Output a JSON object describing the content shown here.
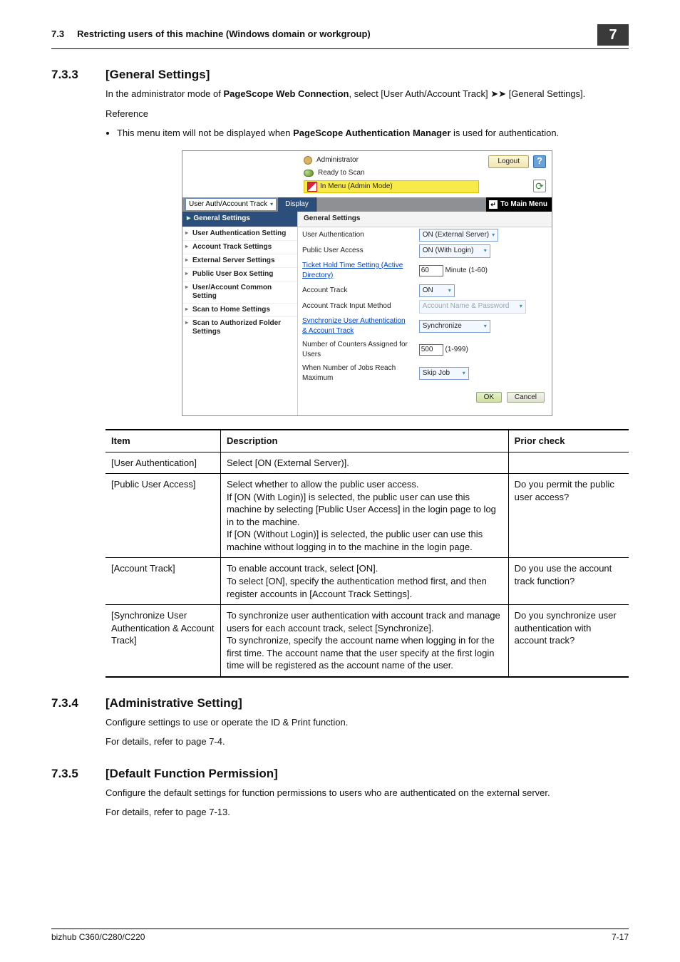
{
  "header": {
    "section_number": "7.3",
    "title": "Restricting users of this machine (Windows domain or workgroup)",
    "chapter": "7"
  },
  "sec_733": {
    "num": "7.3.3",
    "title": "[General Settings]",
    "intro_pre": "In the administrator mode of ",
    "intro_bold1": "PageScope Web Connection",
    "intro_mid": ", select [User Auth/Account Track] ",
    "intro_arrow": "➤➤",
    "intro_post": " [General Settings].",
    "reference_label": "Reference",
    "bullet_pre": "This menu item will not be displayed when ",
    "bullet_bold": "PageScope Authentication Manager",
    "bullet_post": " is used for authentication."
  },
  "panel": {
    "admin_label": "Administrator",
    "logout": "Logout",
    "help": "?",
    "ready": "Ready to Scan",
    "mode": "In Menu (Admin Mode)",
    "bar_select": "User Auth/Account Track",
    "display": "Display",
    "to_main": "To Main Menu",
    "nav_head": "General Settings",
    "nav_items": [
      "User Authentication Setting",
      "Account Track Settings",
      "External Server Settings",
      "Public User Box Setting",
      "User/Account Common Setting",
      "Scan to Home Settings",
      "Scan to Authorized Folder Settings"
    ],
    "title": "General Settings",
    "rows": {
      "ua_label": "User Authentication",
      "ua_value": "ON (External Server)",
      "pua_label": "Public User Access",
      "pua_value": "ON (With Login)",
      "ticket_label": "Ticket Hold Time Setting (Active Directory)",
      "ticket_value": "60",
      "ticket_suffix": "Minute (1-60)",
      "at_label": "Account Track",
      "at_value": "ON",
      "atim_label": "Account Track Input Method",
      "atim_value": "Account Name & Password",
      "sync_label": "Synchronize User Authentication & Account Track",
      "sync_value": "Synchronize",
      "num_label": "Number of Counters Assigned for Users",
      "num_value": "500",
      "num_suffix": "(1-999)",
      "max_label": "When Number of Jobs Reach Maximum",
      "max_value": "Skip Job"
    },
    "ok": "OK",
    "cancel": "Cancel"
  },
  "table": {
    "head_item": "Item",
    "head_desc": "Description",
    "head_prior": "Prior check",
    "rows": [
      {
        "item": "[User Authentication]",
        "desc": "Select [ON (External Server)].",
        "prior": ""
      },
      {
        "item": "[Public User Access]",
        "desc": "Select whether to allow the public user access.\nIf [ON (With Login)] is selected, the public user can use this machine by selecting [Public User Access] in the login page to log in to the machine.\nIf [ON (Without Login)] is selected, the public user can use this machine without logging in to the machine in the login page.",
        "prior": "Do you permit the public user access?"
      },
      {
        "item": "[Account Track]",
        "desc": "To enable account track, select [ON].\nTo select [ON], specify the authentication method first, and then register accounts in [Account Track Settings].",
        "prior": "Do you use the account track function?"
      },
      {
        "item": "[Synchronize User Authentication & Account Track]",
        "desc": "To synchronize user authentication with account track and manage users for each account track, select [Synchronize].\nTo synchronize, specify the account name when logging in for the first time. The account name that the user specify at the first login time will be registered as the account name of the user.",
        "prior": "Do you synchronize user authentication with account track?"
      }
    ]
  },
  "sec_734": {
    "num": "7.3.4",
    "title": "[Administrative Setting]",
    "l1": "Configure settings to use or operate the ID & Print function.",
    "l2": "For details, refer to page 7-4."
  },
  "sec_735": {
    "num": "7.3.5",
    "title": "[Default Function Permission]",
    "l1": "Configure the default settings for function permissions to users who are authenticated on the external server.",
    "l2": "For details, refer to page 7-13."
  },
  "footer": {
    "model": "bizhub C360/C280/C220",
    "page": "7-17"
  }
}
